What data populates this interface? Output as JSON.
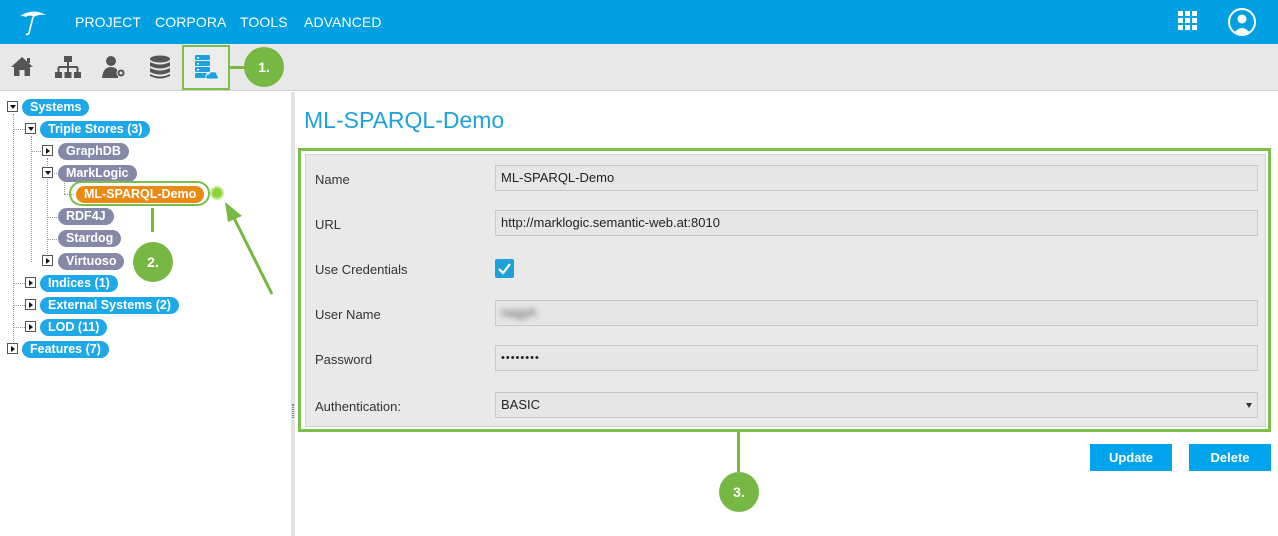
{
  "nav": {
    "items": [
      {
        "label": "PROJECT"
      },
      {
        "label": "CORPORA"
      },
      {
        "label": "TOOLS"
      },
      {
        "label": "ADVANCED"
      }
    ]
  },
  "icons": {
    "logo": "umbrella-logo-icon",
    "apps": "grid-apps-icon",
    "user": "user-avatar-icon",
    "home": "home-icon",
    "hierarchy": "hierarchy-icon",
    "user_settings": "user-gear-icon",
    "database": "database-icon",
    "database_cloud": "database-cloud-icon"
  },
  "callouts": {
    "one": "1.",
    "two": "2.",
    "three": "3."
  },
  "tree": {
    "systems": "Systems",
    "triple_stores": "Triple Stores (3)",
    "graphdb": "GraphDB",
    "marklogic": "MarkLogic",
    "ml_demo": "ML-SPARQL-Demo",
    "rdf4j": "RDF4J",
    "stardog": "Stardog",
    "virtuoso": "Virtuoso",
    "indices": "Indices (1)",
    "external": "External Systems (2)",
    "lod": "LOD (11)",
    "features": "Features (7)"
  },
  "detail": {
    "title": "ML-SPARQL-Demo",
    "name_label": "Name",
    "name_value": "ML-SPARQL-Demo",
    "url_label": "URL",
    "url_value": "http://marklogic.semantic-web.at:8010",
    "credentials_label": "Use Credentials",
    "credentials_checked": true,
    "username_label": "User Name",
    "username_value": "nagyh",
    "password_label": "Password",
    "password_value": "••••••••",
    "auth_label": "Authentication:",
    "auth_value": "BASIC",
    "update_label": "Update",
    "delete_label": "Delete"
  },
  "colors": {
    "primary": "#00a0e3",
    "callout_green": "#76b843",
    "node_blue": "#1ea8e8",
    "node_gray": "#8588a6",
    "node_selected": "#ea8a15"
  }
}
